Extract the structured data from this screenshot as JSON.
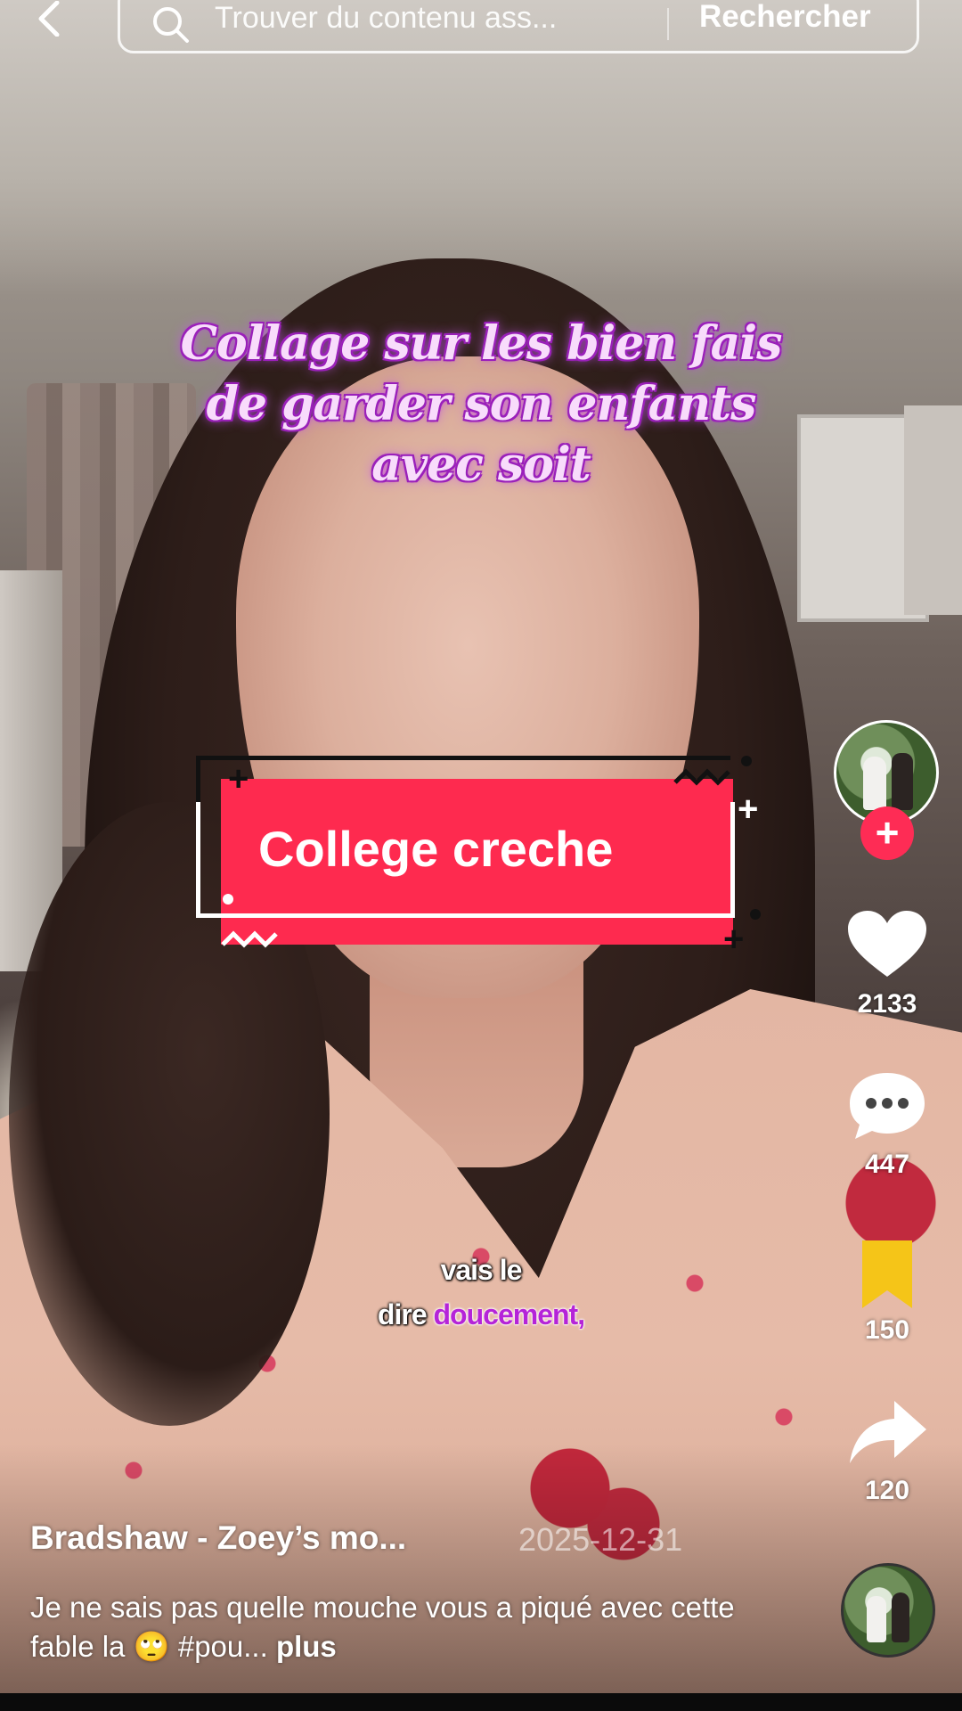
{
  "search": {
    "placeholder": "Trouver du contenu ass...",
    "button_label": "Rechercher"
  },
  "video": {
    "title_overlay_lines": [
      "Collage sur les bien fais",
      "de garder son enfants",
      "avec soit"
    ],
    "badge_text": "College creche",
    "caption_line1": "vais le",
    "caption_line2_plain": "dire",
    "caption_line2_highlight": "doucement,"
  },
  "actions": {
    "follow_label": "+",
    "likes": "2133",
    "comments": "447",
    "saves": "150",
    "shares": "120"
  },
  "post": {
    "author": "Bradshaw - Zoey’s mo...",
    "date": "2025-12-31",
    "description": "Je ne sais pas quelle mouche vous a piqué avec cette fable la 🙄 #pou...",
    "more_label": "plus"
  },
  "icons": [
    "back-chevron-icon",
    "search-icon",
    "heart-icon",
    "comment-icon",
    "bookmark-icon",
    "share-icon",
    "music-disc-icon"
  ],
  "colors": {
    "accent_red": "#fe2a4f",
    "follow_red": "#fe2c55",
    "bookmark_yellow": "#f5c518",
    "title_purple": "#9b20b8"
  }
}
